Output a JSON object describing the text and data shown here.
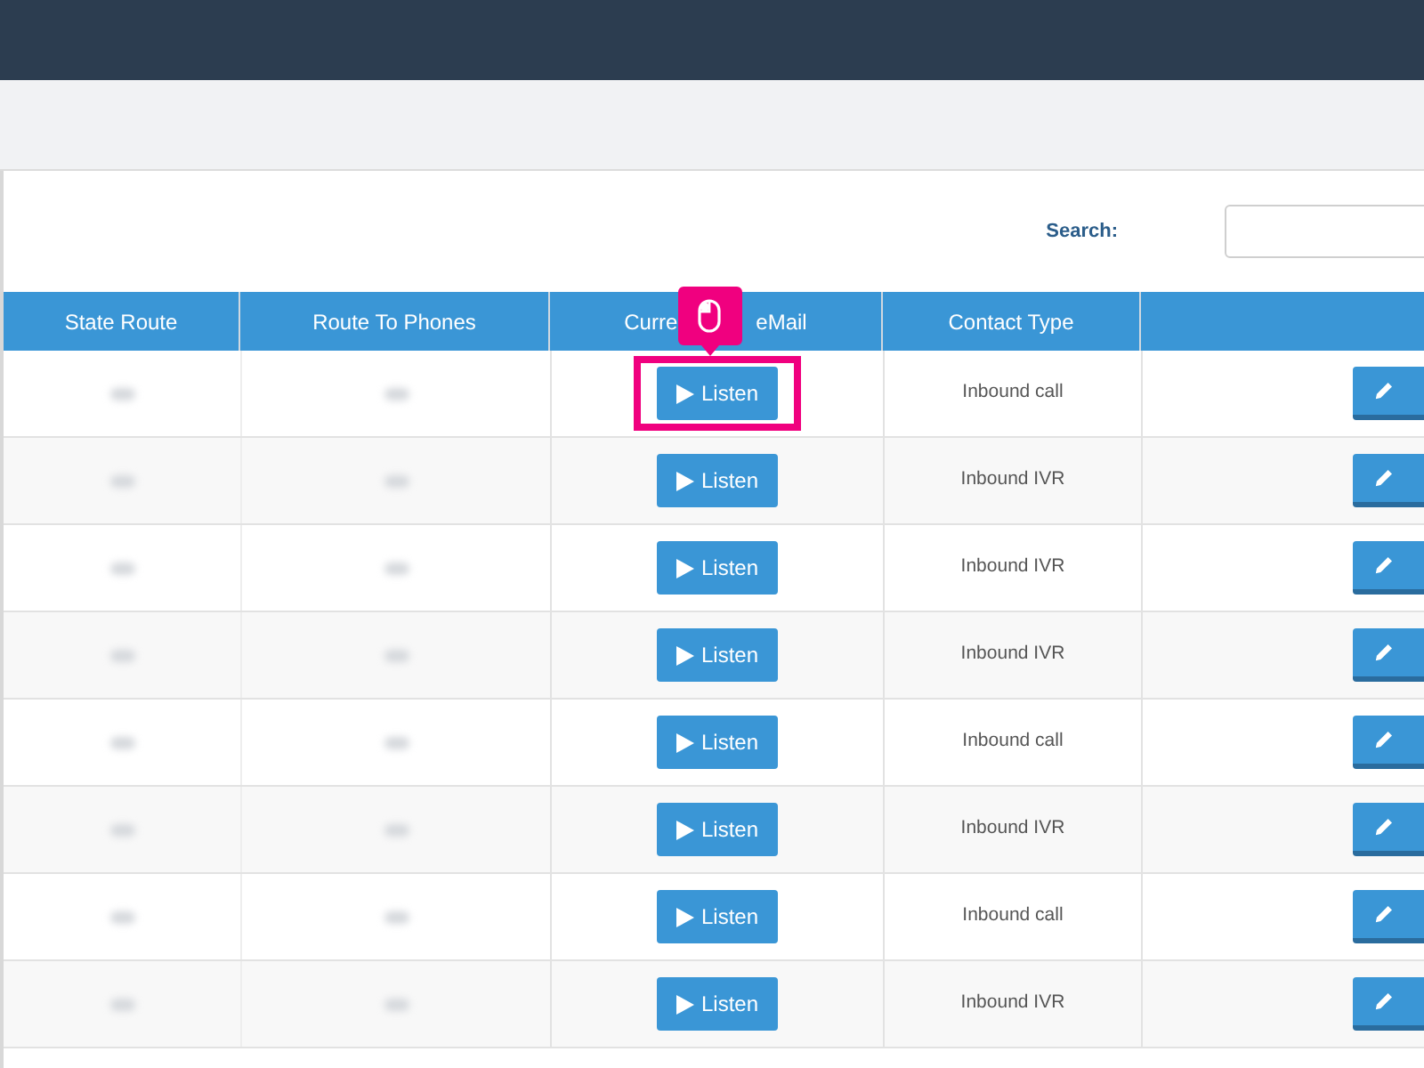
{
  "search": {
    "label": "Search:"
  },
  "table": {
    "columns": [
      {
        "title_parts": [
          "State Route"
        ]
      },
      {
        "title_parts": [
          "Route To Phones"
        ]
      },
      {
        "title_parts": [
          "Curre",
          "eMail"
        ]
      },
      {
        "title_parts": [
          "Contact Type"
        ]
      },
      {}
    ],
    "rows": [
      {
        "listen": "Listen",
        "contact_type": "Inbound call",
        "highlighted": true
      },
      {
        "listen": "Listen",
        "contact_type": "Inbound IVR",
        "highlighted": false
      },
      {
        "listen": "Listen",
        "contact_type": "Inbound IVR",
        "highlighted": false
      },
      {
        "listen": "Listen",
        "contact_type": "Inbound IVR",
        "highlighted": false
      },
      {
        "listen": "Listen",
        "contact_type": "Inbound call",
        "highlighted": false
      },
      {
        "listen": "Listen",
        "contact_type": "Inbound IVR",
        "highlighted": false
      },
      {
        "listen": "Listen",
        "contact_type": "Inbound call",
        "highlighted": false
      },
      {
        "listen": "Listen",
        "contact_type": "Inbound IVR",
        "highlighted": false
      }
    ]
  }
}
